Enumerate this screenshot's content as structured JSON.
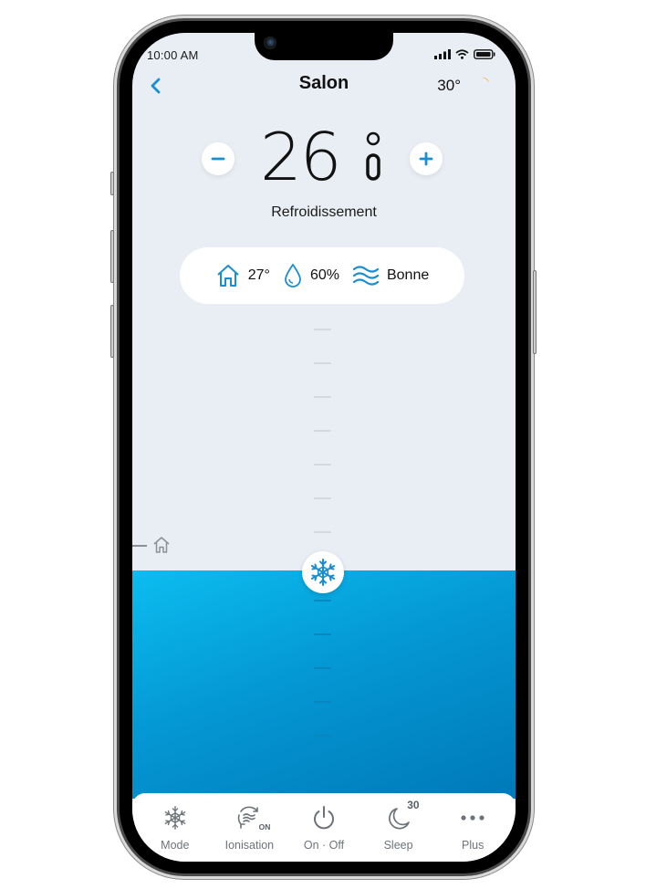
{
  "status_bar": {
    "time": "10:00 AM"
  },
  "header": {
    "title": "Salon",
    "back_icon": "chevron-left-icon",
    "outdoor_temp": "30°",
    "weather_icon": "moon-icon"
  },
  "setpoint": {
    "value": "26",
    "unit": "°",
    "decrease_icon": "minus-icon",
    "increase_icon": "plus-icon",
    "mode_label": "Refroidissement"
  },
  "indicators": [
    {
      "icon": "home-icon",
      "value": "27°"
    },
    {
      "icon": "droplet-icon",
      "value": "60%"
    },
    {
      "icon": "air-quality-icon",
      "value": "Bonne"
    }
  ],
  "slider": {
    "knob_icon": "snowflake-icon",
    "marker_icon": "home-icon"
  },
  "bottom_nav": [
    {
      "icon": "snowflake-icon",
      "label": "Mode"
    },
    {
      "icon": "ionisation-icon",
      "label": "Ionisation",
      "badge": "ON"
    },
    {
      "icon": "power-icon",
      "label": "On · Off"
    },
    {
      "icon": "moon-sleep-icon",
      "label": "Sleep",
      "badge": "30"
    },
    {
      "icon": "more-icon",
      "label": "Plus"
    }
  ],
  "colors": {
    "accent": "#1a8fd0",
    "fill_top": "#0bbdf0",
    "fill_bottom": "#0079b8",
    "background": "#e9eef4"
  }
}
